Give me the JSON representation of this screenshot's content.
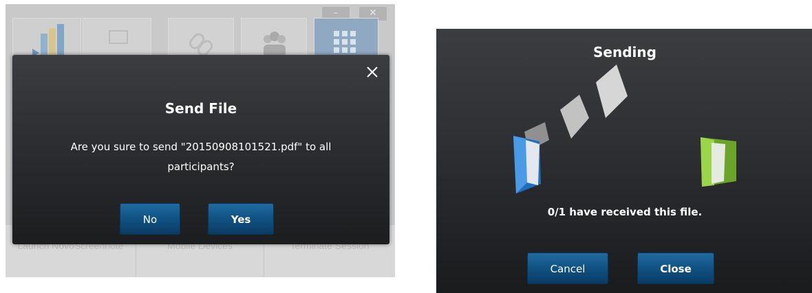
{
  "left_dialog": {
    "title": "Send File",
    "message": "Are you sure to send \"20150908101521.pdf\" to all participants?",
    "no_label": "No",
    "yes_label": "Yes",
    "close_icon": "close-icon"
  },
  "background_app": {
    "window_controls": {
      "minimize": "–",
      "close": "✕"
    },
    "bottom_items": [
      {
        "label": "Launch NovoScreennote"
      },
      {
        "label": "Mobile Devices"
      },
      {
        "label": "Terminate Session"
      }
    ]
  },
  "right_dialog": {
    "title": "Sending",
    "status": "0/1 have received this file.",
    "cancel_label": "Cancel",
    "close_label": "Close"
  },
  "colors": {
    "dialog_bg": "#2c2e31",
    "button_blue": "#0f4f80",
    "folder_blue": "#3a8ee0",
    "folder_green": "#8cc63f"
  }
}
